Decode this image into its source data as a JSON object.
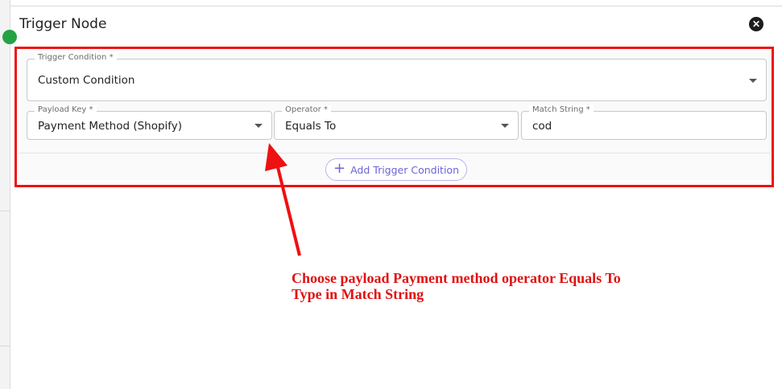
{
  "modal": {
    "title": "Trigger Node",
    "close_icon": "close-icon"
  },
  "trigger_condition": {
    "label": "Trigger Condition *",
    "value": "Custom Condition"
  },
  "payload_key": {
    "label": "Payload Key *",
    "value": "Payment Method (Shopify)"
  },
  "operator": {
    "label": "Operator *",
    "value": "Equals To"
  },
  "match_string": {
    "label": "Match String *",
    "value": "cod"
  },
  "add_condition": {
    "label": "Add Trigger Condition",
    "icon": "plus-icon"
  },
  "annotation": {
    "line1": "Choose payload Payment method operator Equals To",
    "line2": "Type in Match String"
  },
  "colors": {
    "highlight": "#ee1111",
    "accent": "#6c63d9"
  }
}
